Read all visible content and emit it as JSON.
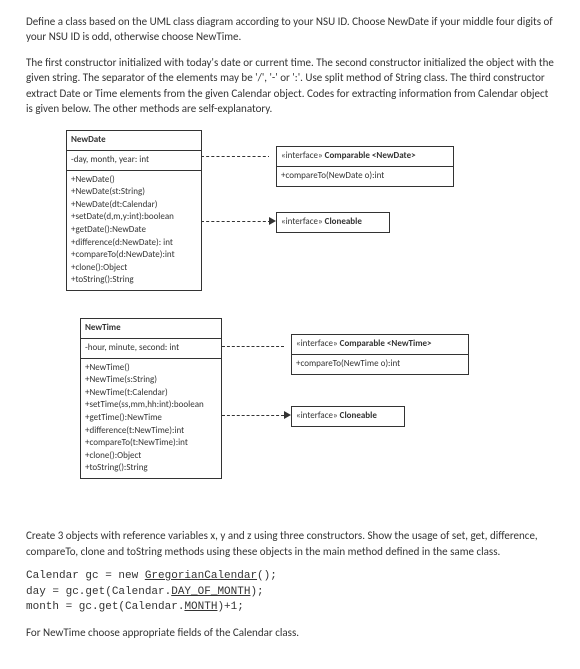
{
  "intro": {
    "p1": "Define a class based on the UML class diagram according to your NSU ID. Choose NewDate if your middle four digits of your NSU ID is odd, otherwise choose NewTime.",
    "p2": "The first constructor initialized with today's date or current time. The second constructor initialized the object with the given string. The separator of the elements may be '/', '-' or ':'. Use split method of String class. The third constructor extract Date or Time elements from the given Calendar object. Codes for extracting information from Calendar object is given below. The other methods are self-explanatory."
  },
  "newdate": {
    "name": "NewDate",
    "attrs": "-day, month, year: int",
    "ops": [
      "+NewDate()",
      "+NewDate(st:String)",
      "+NewDate(dt:Calendar)",
      "+setDate(d,m,y:int):boolean",
      "+getDate():NewDate",
      "+difference(d:NewDate): int",
      "+compareTo(d:NewDate):int",
      "+clone():Object",
      "+toString():String"
    ]
  },
  "newtime": {
    "name": "NewTime",
    "attrs": "-hour, minute, second: int",
    "ops": [
      "+NewTime()",
      "+NewTime(s:String)",
      "+NewTime(t:Calendar)",
      "+setTime(ss,mm,hh:int):boolean",
      "+getTime():NewTime",
      "+difference(t:NewTime):int",
      "+compareTo(t:NewTime):int",
      "+clone():Object",
      "+toString():String"
    ]
  },
  "ifaces": {
    "comp_date_stereo": "«interface»",
    "comp_date_name": " Comparable <NewDate>",
    "comp_date_method": "+compareTo(NewDate o):int",
    "clone_date_stereo": "«interface»",
    "clone_date_name": " Cloneable",
    "comp_time_stereo": "«interface»",
    "comp_time_name": " Comparable <NewTime>",
    "comp_time_method": "+compareTo(NewTime o):int",
    "clone_time_stereo": "«interface»",
    "clone_time_name": " Cloneable"
  },
  "tail": {
    "p1": "Create 3 objects with reference variables x, y and z using three constructors. Show the usage of set, get, difference, compareTo, clone and toString methods using these objects in the main method defined in the same class.",
    "code_l1_a": "Calendar gc = new ",
    "code_l1_b": "GregorianCalendar",
    "code_l1_c": "();",
    "code_l2_a": "day = gc.get(Calendar.",
    "code_l2_b": "DAY_OF_MONTH",
    "code_l2_c": ");",
    "code_l3_a": "month = gc.get(Calendar.",
    "code_l3_b": "MONTH",
    "code_l3_c": ")+1;",
    "p2": "For NewTime choose appropriate fields of the Calendar class."
  }
}
